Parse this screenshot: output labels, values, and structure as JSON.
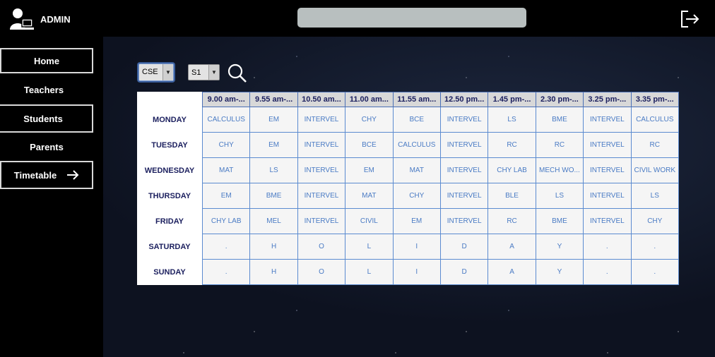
{
  "header": {
    "admin_label": "ADMIN",
    "admin_icon": "admin-user-icon",
    "logout_icon": "logout-icon"
  },
  "sidebar": {
    "items": [
      {
        "label": "Home"
      },
      {
        "label": "Teachers"
      },
      {
        "label": "Students"
      },
      {
        "label": "Parents"
      },
      {
        "label": "Timetable"
      }
    ]
  },
  "filters": {
    "department": "CSE",
    "semester": "S1",
    "search_icon": "search-icon"
  },
  "timetable": {
    "times": [
      "9.00 am-...",
      "9.55 am-...",
      "10.50 am...",
      "11.00 am...",
      "11.55 am...",
      "12.50 pm...",
      "1.45 pm-...",
      "2.30 pm-...",
      "3.25 pm-...",
      "3.35 pm-..."
    ],
    "rows": [
      {
        "day": "MONDAY",
        "cells": [
          "CALCULUS",
          "EM",
          "INTERVEL",
          "CHY",
          "BCE",
          "INTERVEL",
          "LS",
          "BME",
          "INTERVEL",
          "CALCULUS"
        ]
      },
      {
        "day": "TUESDAY",
        "cells": [
          "CHY",
          "EM",
          "INTERVEL",
          "BCE",
          "CALCULUS",
          "INTERVEL",
          "RC",
          "RC",
          "INTERVEL",
          "RC"
        ]
      },
      {
        "day": "WEDNESDAY",
        "cells": [
          "MAT",
          "LS",
          "INTERVEL",
          "EM",
          "MAT",
          "INTERVEL",
          "CHY LAB",
          "MECH WO...",
          "INTERVEL",
          "CIVIL WORK"
        ]
      },
      {
        "day": "THURSDAY",
        "cells": [
          "EM",
          "BME",
          "INTERVEL",
          "MAT",
          "CHY",
          "INTERVEL",
          "BLE",
          "LS",
          "INTERVEL",
          "LS"
        ]
      },
      {
        "day": "FRIDAY",
        "cells": [
          "CHY LAB",
          "MEL",
          "INTERVEL",
          "CIVIL",
          "EM",
          "INTERVEL",
          "RC",
          "BME",
          "INTERVEL",
          "CHY"
        ]
      },
      {
        "day": "SATURDAY",
        "cells": [
          ".",
          "H",
          "O",
          "L",
          "I",
          "D",
          "A",
          "Y",
          ".",
          "."
        ]
      },
      {
        "day": "SUNDAY",
        "cells": [
          ".",
          "H",
          "O",
          "L",
          "I",
          "D",
          "A",
          "Y",
          ".",
          "."
        ]
      }
    ]
  }
}
